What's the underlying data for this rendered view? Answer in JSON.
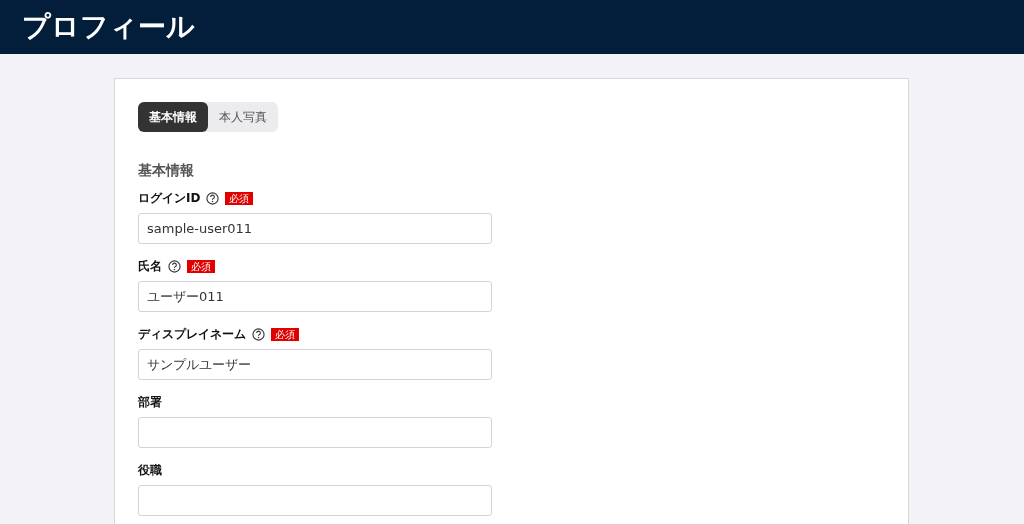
{
  "header": {
    "title": "プロフィール"
  },
  "tabs": [
    {
      "label": "基本情報",
      "selected": true
    },
    {
      "label": "本人写真",
      "selected": false
    }
  ],
  "section_title": "基本情報",
  "fields": [
    {
      "label": "ログインID",
      "help": true,
      "badge": "必須",
      "value": "sample-user011"
    },
    {
      "label": "氏名",
      "help": true,
      "badge": "必須",
      "value": "ユーザー011"
    },
    {
      "label": "ディスプレイネーム",
      "help": true,
      "badge": "必須",
      "value": "サンプルユーザー"
    },
    {
      "label": "部署",
      "help": false
    },
    {
      "label": "役職",
      "help": false
    }
  ]
}
